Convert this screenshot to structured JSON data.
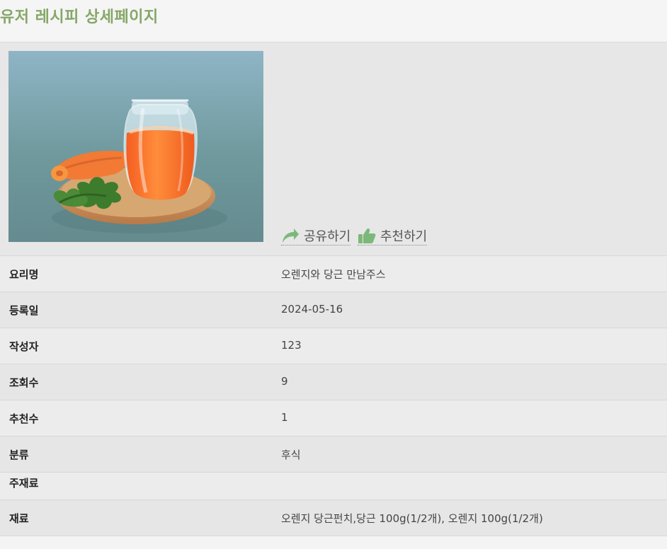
{
  "header": {
    "title": "유저 레시피 상세페이지"
  },
  "actions": {
    "share_label": "공유하기",
    "recommend_label": "추천하기"
  },
  "recipe": {
    "rows": [
      {
        "label": "요리명",
        "value": "오렌지와 당근 만남주스"
      },
      {
        "label": "등록일",
        "value": "2024-05-16"
      },
      {
        "label": "작성자",
        "value": "123"
      },
      {
        "label": "조회수",
        "value": "9"
      },
      {
        "label": "추천수",
        "value": "1"
      },
      {
        "label": "분류",
        "value": "후식"
      },
      {
        "label": "주재료",
        "value": ""
      },
      {
        "label": "재료",
        "value": "오렌지 당근펀치,당근 100g(1/2개), 오렌지 100g(1/2개)"
      }
    ]
  },
  "colors": {
    "title": "#86a768",
    "icon_accent": "#7cb87a"
  },
  "icons": {
    "share": "share-arrow-icon",
    "recommend": "thumbs-up-icon"
  }
}
